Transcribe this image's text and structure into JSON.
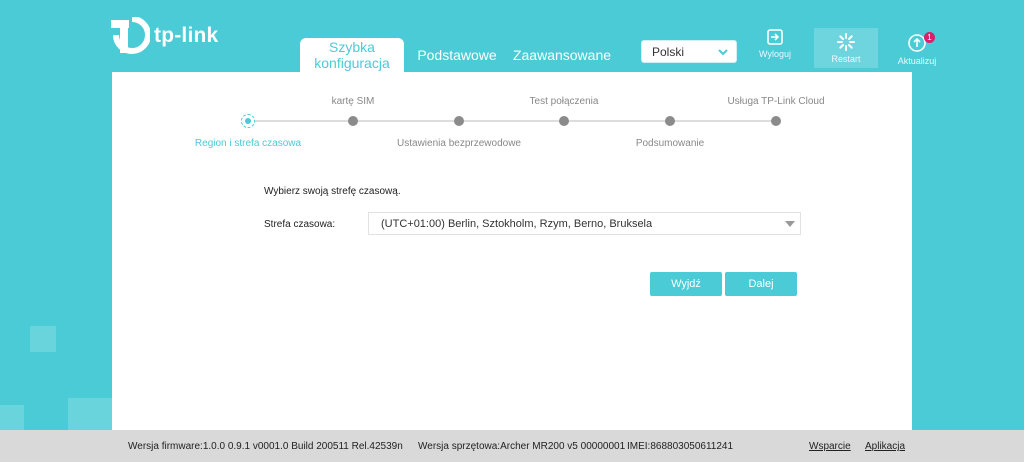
{
  "header": {
    "logo_text": "tp-link",
    "tabs": [
      {
        "label": "Szybka konfiguracja",
        "active": true
      },
      {
        "label": "Podstawowe",
        "active": false
      },
      {
        "label": "Zaawansowane",
        "active": false
      }
    ],
    "language": "Polski",
    "logout_label": "Wyloguj",
    "restart_label": "Restart",
    "update_label": "Aktualizuj",
    "update_badge": "1"
  },
  "stepper": {
    "steps": [
      {
        "label": "Region i strefa czasowa",
        "position": "below",
        "active": true
      },
      {
        "label": "kartę SIM",
        "position": "above",
        "active": false
      },
      {
        "label": "Ustawienia bezprzewodowe",
        "position": "below",
        "active": false
      },
      {
        "label": "Test połączenia",
        "position": "above",
        "active": false
      },
      {
        "label": "Podsumowanie",
        "position": "below",
        "active": false
      },
      {
        "label": "Usługa TP-Link Cloud",
        "position": "above",
        "active": false
      }
    ]
  },
  "form": {
    "instruction": "Wybierz swoją strefę czasową.",
    "timezone_label": "Strefa czasowa:",
    "timezone_value": "(UTC+01:00) Berlin, Sztokholm, Rzym, Berno, Bruksela"
  },
  "buttons": {
    "exit": "Wyjdź",
    "next": "Dalej"
  },
  "footer": {
    "firmware": "Wersja firmware:1.0.0 0.9.1 v0001.0 Build 200511 Rel.42539n",
    "hardware": "Wersja sprzętowa:Archer MR200 v5 00000001",
    "imei": "IMEI:868803050611241",
    "support": "Wsparcie",
    "app": "Aplikacja"
  },
  "colors": {
    "accent": "#4acbd6",
    "badge": "#d6226b"
  }
}
